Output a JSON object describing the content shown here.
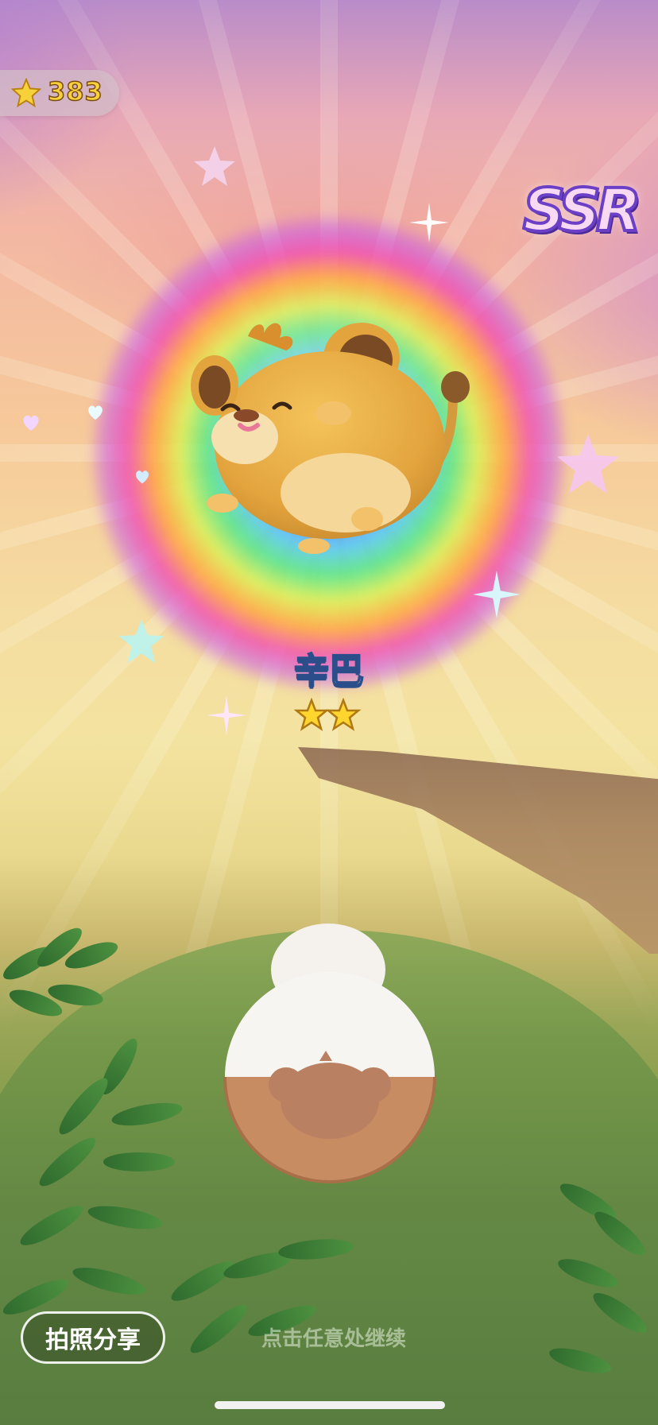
{
  "currency": {
    "icon": "star-icon",
    "value": "383"
  },
  "rarity_badge": "SSR",
  "character": {
    "name": "辛巴",
    "star_rating": 2
  },
  "share_button_label": "拍照分享",
  "continue_hint": "点击任意处继续",
  "colors": {
    "star_gold": "#f6d13a",
    "badge_outline": "#6b3fc6",
    "name_outline": "#2b4e8a"
  }
}
